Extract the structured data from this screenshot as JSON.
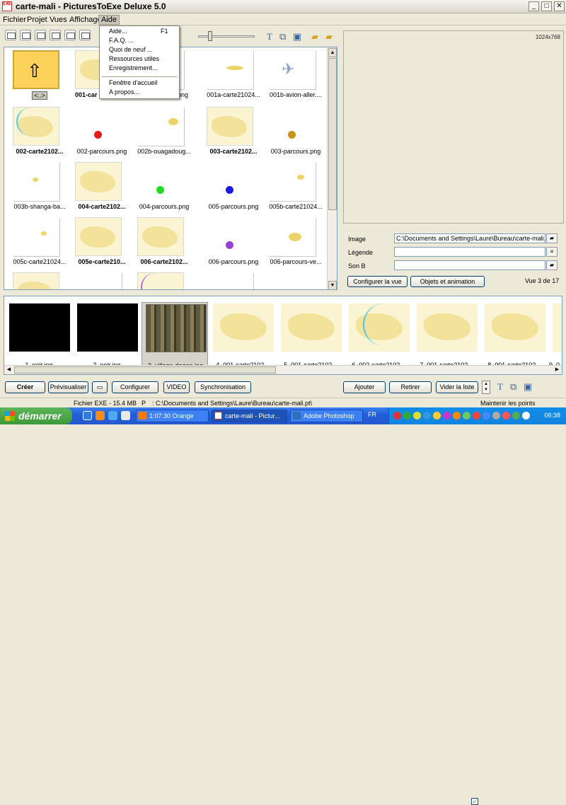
{
  "window": {
    "title": "carte-mali - PicturesToExe Deluxe 5.0",
    "app_icon_text": "EXE"
  },
  "menubar": {
    "items": [
      "Fichier",
      "Projet",
      "Vues",
      "Affichage",
      "Aide"
    ]
  },
  "aide_menu": {
    "items": [
      {
        "label": "Aide...",
        "shortcut": "F1"
      },
      {
        "label": "F.A.Q. ..."
      },
      {
        "label": "Quoi de neuf ..."
      },
      {
        "label": "Ressources utiles"
      },
      {
        "label": "Enregistrement..."
      },
      {
        "label": "Fenêtre d'accueil"
      },
      {
        "label": "A propos..."
      }
    ]
  },
  "browser": {
    "items": [
      {
        "label": "<..>",
        "type": "folder"
      },
      {
        "label": "001-car",
        "type": "map",
        "bold": true
      },
      {
        "label": "png",
        "type": "sep"
      },
      {
        "label": "001a-carte21024...",
        "type": "sep"
      },
      {
        "label": "001b-avion-aller....",
        "type": "plane"
      },
      {
        "label": "002-carte2102...",
        "type": "map",
        "bold": true
      },
      {
        "label": "002-parcours.png",
        "type": "dot",
        "color": "#E31B1B"
      },
      {
        "label": "002b-ouagadoug...",
        "type": "sep"
      },
      {
        "label": "003-carte2102...",
        "type": "map",
        "bold": true
      },
      {
        "label": "003-parcours.png",
        "type": "dot",
        "color": "#C9931B"
      },
      {
        "label": "003b-shanga-ba...",
        "type": "sep"
      },
      {
        "label": "004-carte2102...",
        "type": "map",
        "bold": true
      },
      {
        "label": "004-parcours.png",
        "type": "dot",
        "color": "#22DD22"
      },
      {
        "label": "005-parcours.png",
        "type": "dot",
        "color": "#1C1CE0"
      },
      {
        "label": "005b-carte21024...",
        "type": "sep"
      },
      {
        "label": "005c-carte21024...",
        "type": "sep"
      },
      {
        "label": "005e-carte210...",
        "type": "map",
        "bold": true
      },
      {
        "label": "006-carte2102...",
        "type": "map",
        "bold": true
      },
      {
        "label": "006-parcours.png",
        "type": "dot",
        "color": "#9A3FD6"
      },
      {
        "label": "006-parcours-ve...",
        "type": "sep"
      }
    ]
  },
  "preview": {
    "resolution": "1024x768"
  },
  "properties": {
    "image_label": "Image",
    "image_value": "C:\\Documents and Settings\\Laure\\Bureau\\carte-mali.pt\\",
    "legende_label": "Légende",
    "legende_value": "",
    "son_label": "Son B",
    "son_value": "",
    "configurer_vue": "Configurer la vue",
    "objets_animation": "Objets et animation",
    "vue_info": "Vue 3 de 17"
  },
  "timeline": {
    "items": [
      {
        "label": "1. noir.jpg",
        "type": "black"
      },
      {
        "label": "2. noir.jpg",
        "type": "black"
      },
      {
        "label": "3. village-dogon.jpg",
        "type": "photo",
        "selected": true
      },
      {
        "label": "4. 001-carte2102...",
        "type": "map"
      },
      {
        "label": "5. 001-carte2102...",
        "type": "map"
      },
      {
        "label": "6. 002-carte2102...",
        "type": "map"
      },
      {
        "label": "7. 001-carte2102...",
        "type": "map"
      },
      {
        "label": "8. 001-carte2102...",
        "type": "map"
      },
      {
        "label": "9. 0",
        "type": "map"
      }
    ]
  },
  "bottom_buttons": {
    "creer": "Créer",
    "previsualiser": "Prévisualiser",
    "configurer": "Configurer",
    "video": "VIDEO",
    "synchronisation": "Synchronisation",
    "ajouter": "Ajouter",
    "retirer": "Retirer",
    "vider": "Vider la liste"
  },
  "status": {
    "file": "Fichier EXE - 15.4 MB",
    "p": "P",
    "path": ": C:\\Documents and Settings\\Laure\\Bureau\\carte-mali.pt\\",
    "maintenir": "Maintenir les points"
  },
  "taskbar": {
    "start": "démarrer",
    "tasks": [
      {
        "label": "1:07:30 Orange",
        "active": false
      },
      {
        "label": "carte-mali - Pictur...",
        "active": true
      },
      {
        "label": "Adobe Photoshop",
        "active": false
      }
    ],
    "lang": "FR",
    "clock": "06:38"
  }
}
